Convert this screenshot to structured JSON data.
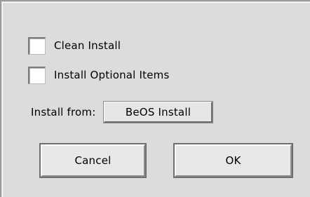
{
  "options": {
    "clean_install": {
      "label": "Clean Install",
      "checked": false
    },
    "install_optional_items": {
      "label": "Install Optional Items",
      "checked": false
    }
  },
  "install_from": {
    "label": "Install from:",
    "selected": "BeOS Install"
  },
  "buttons": {
    "cancel_label": "Cancel",
    "ok_label": "OK"
  },
  "colors": {
    "window_background": "#dcdcdc",
    "checkbox_fill": "#ffffff",
    "button_face": "#e8e8e8"
  }
}
